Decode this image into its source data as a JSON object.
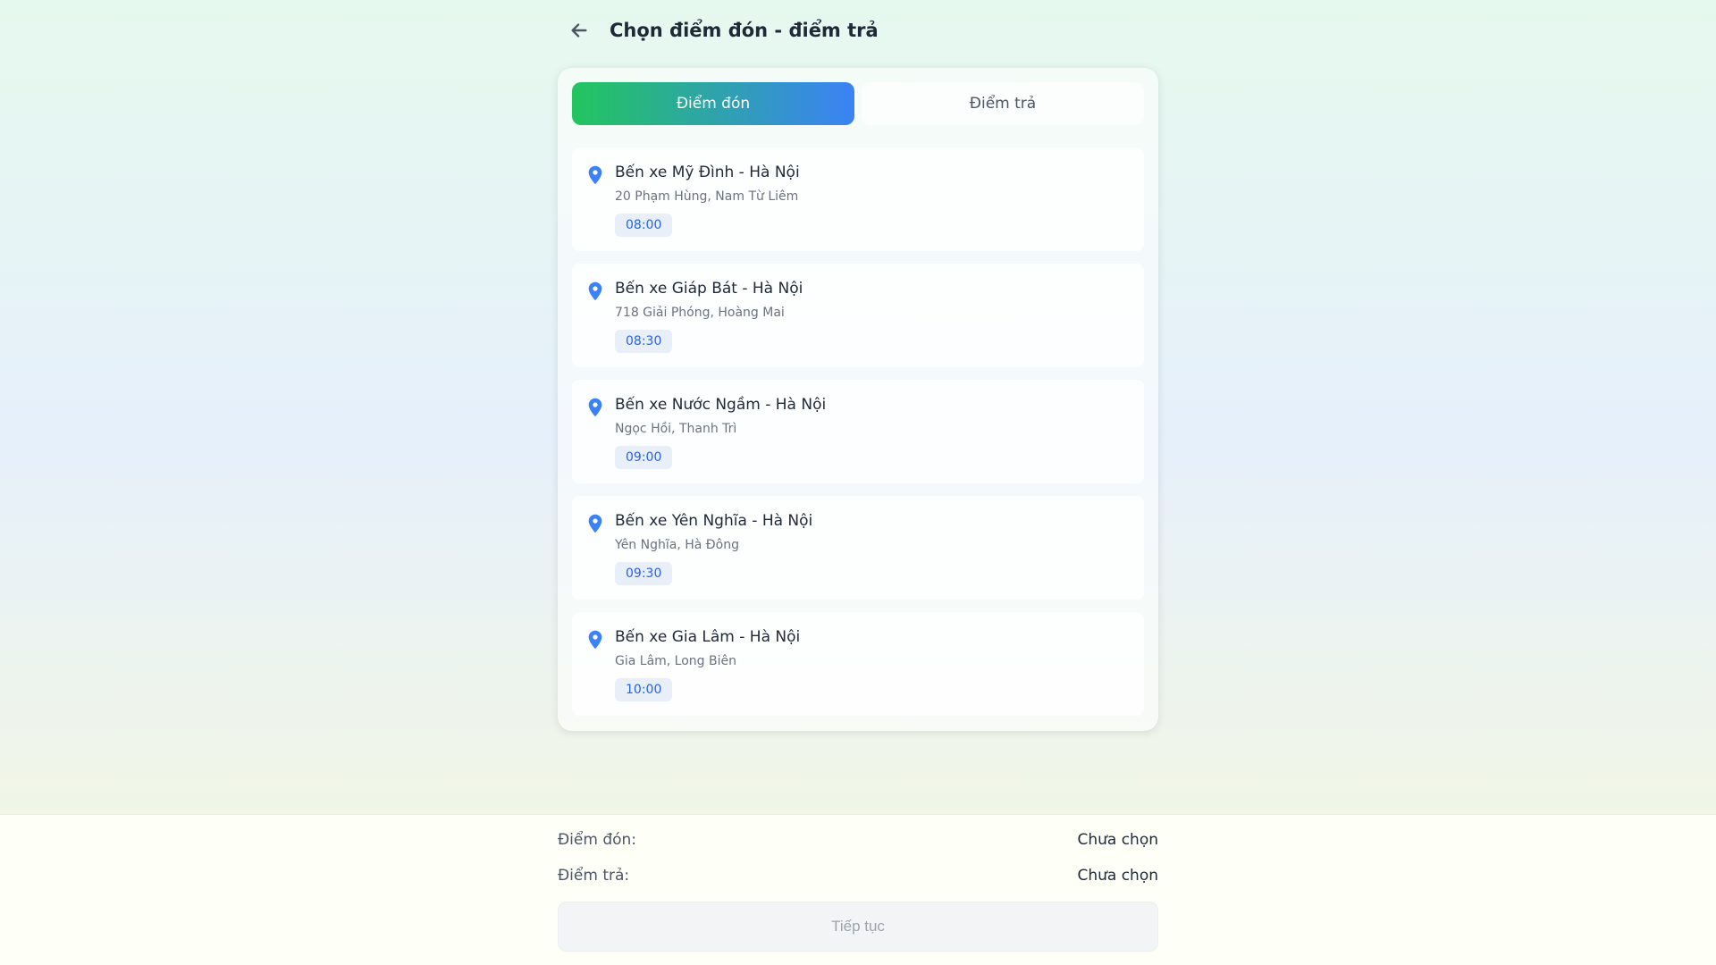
{
  "header": {
    "title": "Chọn điểm đón - điểm trả"
  },
  "tabs": [
    {
      "label": "Điểm đón",
      "active": true
    },
    {
      "label": "Điểm trả",
      "active": false
    }
  ],
  "stops": [
    {
      "name": "Bến xe Mỹ Đình - Hà Nội",
      "address": "20 Phạm Hùng, Nam Từ Liêm",
      "time": "08:00"
    },
    {
      "name": "Bến xe Giáp Bát - Hà Nội",
      "address": "718 Giải Phóng, Hoàng Mai",
      "time": "08:30"
    },
    {
      "name": "Bến xe Nước Ngầm - Hà Nội",
      "address": "Ngọc Hồi, Thanh Trì",
      "time": "09:00"
    },
    {
      "name": "Bến xe Yên Nghĩa - Hà Nội",
      "address": "Yên Nghĩa, Hà Đông",
      "time": "09:30"
    },
    {
      "name": "Bến xe Gia Lâm - Hà Nội",
      "address": "Gia Lâm, Long Biên",
      "time": "10:00"
    }
  ],
  "summary": {
    "pickup_label": "Điểm đón:",
    "pickup_value": "Chưa chọn",
    "dropoff_label": "Điểm trả:",
    "dropoff_value": "Chưa chọn"
  },
  "continue_label": "Tiếp tục",
  "colors": {
    "gradient_start": "#22c55e",
    "gradient_end": "#3b82f6",
    "pin": "#3b82f6",
    "time_text": "#2563eb"
  }
}
